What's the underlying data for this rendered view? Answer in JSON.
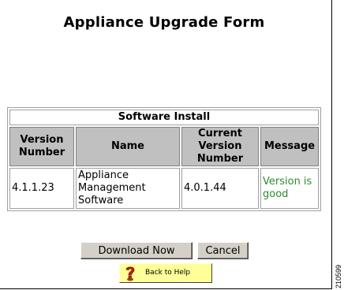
{
  "page": {
    "title": "Appliance Upgrade Form"
  },
  "install_table": {
    "caption": "Software Install",
    "headers": {
      "version_number": "Version Number",
      "name": "Name",
      "current_version_number": "Current Version Number",
      "message": "Message"
    },
    "rows": [
      {
        "version_number": "4.1.1.23",
        "name": "Appliance Management Software",
        "current_version_number": "4.0.1.44",
        "message": "Version is good"
      }
    ]
  },
  "actions": {
    "download_label": "Download Now",
    "cancel_label": "Cancel",
    "help_label": "Back to Help"
  },
  "figure_id": "210599",
  "colors": {
    "message_text": "#2e8b2e",
    "header_bg": "#c0c0c0",
    "help_button_bg": "#ffff99",
    "button_bg": "#d4d0c8"
  },
  "icons": {
    "help": "question-mark-icon"
  }
}
